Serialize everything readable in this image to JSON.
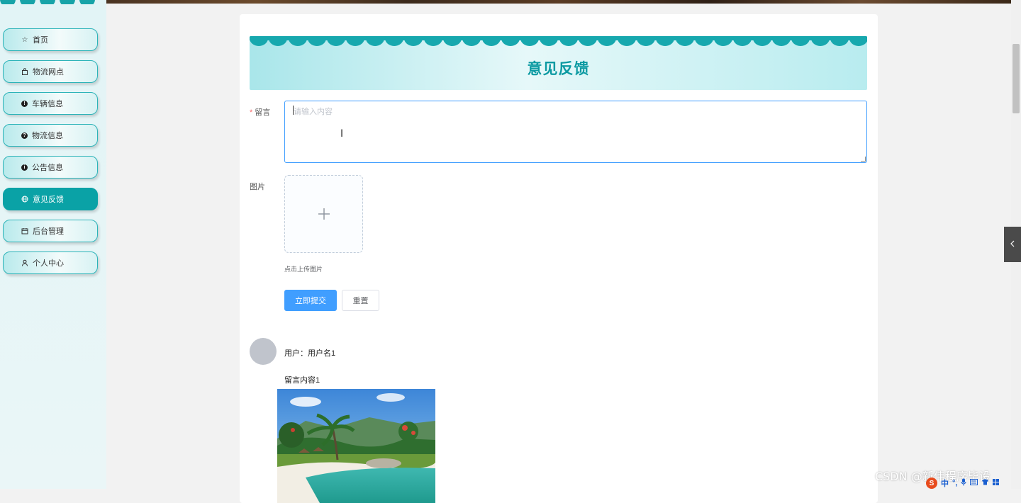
{
  "sidebar": {
    "items": [
      {
        "label": "首页",
        "icon": "star-icon",
        "active": false
      },
      {
        "label": "物流网点",
        "icon": "bag-icon",
        "active": false
      },
      {
        "label": "车辆信息",
        "icon": "info-dot-icon",
        "active": false
      },
      {
        "label": "物流信息",
        "icon": "question-dot-icon",
        "active": false
      },
      {
        "label": "公告信息",
        "icon": "info-dot-icon",
        "active": false
      },
      {
        "label": "意见反馈",
        "icon": "globe-icon",
        "active": true
      },
      {
        "label": "后台管理",
        "icon": "calendar-icon",
        "active": false
      },
      {
        "label": "个人中心",
        "icon": "user-icon",
        "active": false
      }
    ]
  },
  "banner": {
    "title": "意见反馈"
  },
  "form": {
    "message_label": "留言",
    "required_mark": "*",
    "message_placeholder": "请输入内容",
    "image_label": "图片",
    "upload_tip": "点击上传图片",
    "submit_label": "立即提交",
    "reset_label": "重置"
  },
  "comment": {
    "user_line": "用户：用户名1",
    "content": "留言内容1"
  },
  "overlay": {
    "watermark": "CSDN @新伟程序毕设",
    "ime_cn": "中"
  },
  "colors": {
    "accent": "#0aa2a6",
    "primary_button": "#409eff"
  }
}
